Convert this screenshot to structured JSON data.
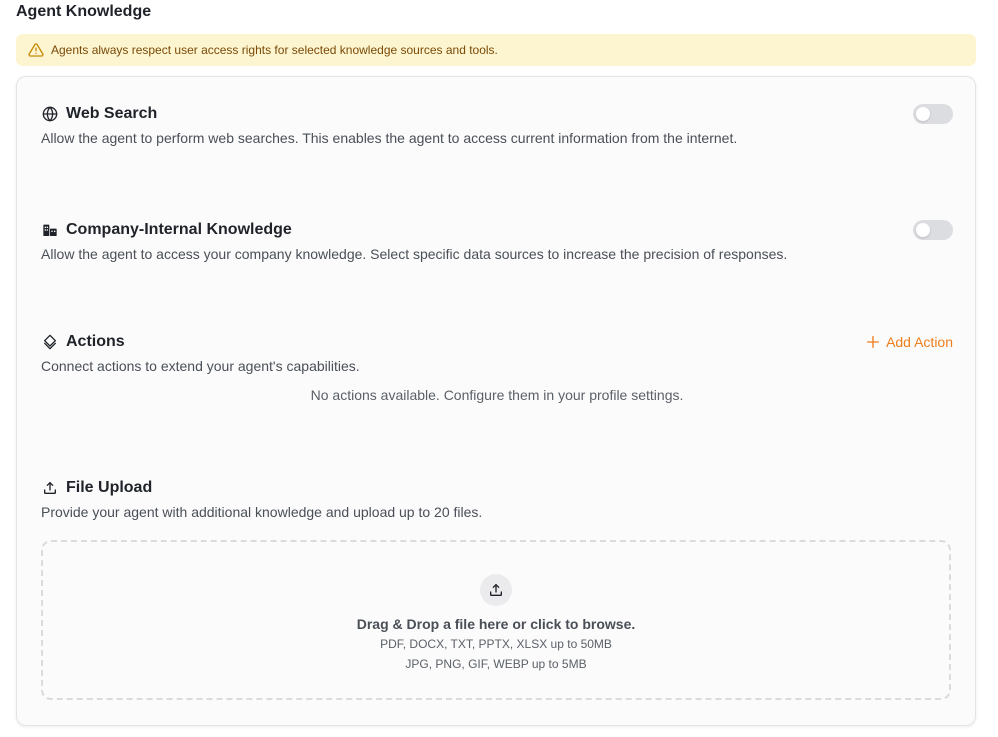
{
  "page": {
    "title": "Agent Knowledge"
  },
  "warning": {
    "icon": "warning-triangle-icon",
    "text": "Agents always respect user access rights for selected knowledge sources and tools."
  },
  "sections": {
    "web_search": {
      "icon": "globe-icon",
      "title": "Web Search",
      "description": "Allow the agent to perform web searches. This enables the agent to access current information from the internet.",
      "enabled": false
    },
    "company_knowledge": {
      "icon": "buildings-icon",
      "title": "Company-Internal Knowledge",
      "description": "Allow the agent to access your company knowledge. Select specific data sources to increase the precision of responses.",
      "enabled": false
    },
    "actions": {
      "icon": "layers-icon",
      "title": "Actions",
      "description": "Connect actions to extend your agent's capabilities.",
      "add_label": "Add Action",
      "empty_text": "No actions available. Configure them in your profile settings."
    },
    "file_upload": {
      "icon": "upload-icon",
      "title": "File Upload",
      "description": "Provide your agent with additional knowledge and upload up to 20 files.",
      "drop_main": "Drag & Drop a file here or click to browse.",
      "drop_docs": "PDF, DOCX, TXT, PPTX, XLSX up to 50MB",
      "drop_images": "JPG, PNG, GIF, WEBP up to 5MB"
    }
  },
  "colors": {
    "accent": "#ef7d1a",
    "warning_bg": "#fdf5cf",
    "warning_text": "#7a4a08",
    "toggle_off": "#dcdde0"
  }
}
